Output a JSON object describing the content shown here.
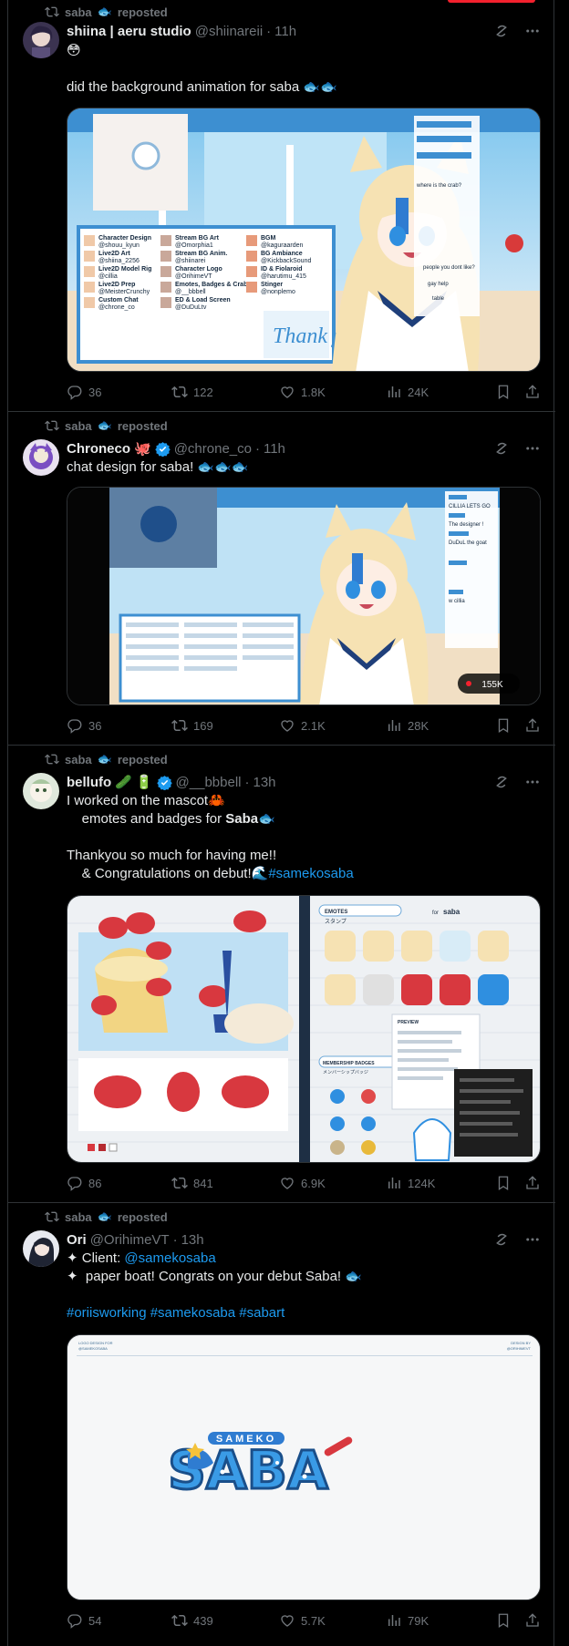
{
  "feed": {
    "tweets": [
      {
        "reposted_by": "saba",
        "reposted_label": "reposted",
        "author": {
          "name": "shiina | aeru studio",
          "handle": "@shiinareii",
          "verified": false
        },
        "time": "11h",
        "text_lines": [
          "😳",
          "",
          "did the background animation for saba 🐟🐟"
        ],
        "media": {
          "credits": [
            {
              "role": "Character Design",
              "name": "@shouu_kyun"
            },
            {
              "role": "Live2D Art",
              "name": "@shiina_2256"
            },
            {
              "role": "Live2D Model Rig",
              "name": "@cillia"
            },
            {
              "role": "Live2D Prep",
              "name": "@MeisterCrunchy"
            },
            {
              "role": "Custom Chat",
              "name": "@chrone_co"
            },
            {
              "role": "Stream BG Art",
              "name": "@Omorphia1"
            },
            {
              "role": "Stream BG Anim.",
              "name": "@shiinarei"
            },
            {
              "role": "Character Logo",
              "name": "@OrihimeVT"
            },
            {
              "role": "Emotes, Badges & Crab",
              "name": "@__bbbell"
            },
            {
              "role": "ED & Load Screen",
              "name": "@DuDuLtv"
            },
            {
              "role": "BGM",
              "name": "@kaguraarden"
            },
            {
              "role": "BG Ambiance",
              "name": "@KickbackSound"
            },
            {
              "role": "ID & Fiolaroid",
              "name": "@harutimu_415"
            },
            {
              "role": "Stinger",
              "name": "@nonplemo"
            }
          ],
          "thanks": "Thank you!",
          "chat_lines": [
            "where is the crab?",
            "people you dont like?",
            "gay help",
            "table"
          ]
        },
        "counts": {
          "replies": "36",
          "reposts": "122",
          "likes": "1.8K",
          "views": "24K"
        }
      },
      {
        "reposted_by": "saba",
        "reposted_label": "reposted",
        "author": {
          "name": "Chroneco",
          "handle": "@chrone_co",
          "verified": true
        },
        "time": "11h",
        "text_lines": [
          "chat design for saba! 🐟🐟🐟"
        ],
        "media": {
          "chat_lines": [
            "CILLIA LETS GO",
            "The designer !",
            "DuDuL the goat",
            "w cillia"
          ],
          "live_count": "155K"
        },
        "counts": {
          "replies": "36",
          "reposts": "169",
          "likes": "2.1K",
          "views": "28K"
        }
      },
      {
        "reposted_by": "saba",
        "reposted_label": "reposted",
        "author": {
          "name": "bellufo",
          "handle": "@__bbbell",
          "verified": true
        },
        "time": "13h",
        "text_lines": [
          "I worked on the mascot🦀",
          "    emotes and badges for ",
          "",
          "Thankyou so much for having me!!",
          "    & Congratulations on debut!🌊"
        ],
        "bold_saba": "Saba🐟",
        "hashtag": "#samekosaba",
        "media": {
          "emotes_label": "EMOTES",
          "emotes_sub": "スタンプ",
          "badges_label": "MEMBERSHIP BADGES",
          "badges_sub": "メンバーシップバッジ",
          "preview_label": "PREVIEW",
          "brand": "saba"
        },
        "counts": {
          "replies": "86",
          "reposts": "841",
          "likes": "6.9K",
          "views": "124K"
        }
      },
      {
        "reposted_by": "saba",
        "reposted_label": "reposted",
        "author": {
          "name": "Ori",
          "handle": "@OrihimeVT",
          "verified": false
        },
        "time": "13h",
        "client_prefix": "✦ Client: ",
        "client_link": "@samekosaba",
        "boat_line": "✦  paper boat! Congrats on your debut Saba! 🐟",
        "hashtags": "#oriisworking #samekosaba #sabart",
        "media": {
          "logo_top": "SAMEKO",
          "logo_main": "SABA",
          "corner_left": "LOGO DESIGN FOR",
          "corner_left2": "@SAMEKOSABA",
          "corner_right": "DESIGN BY",
          "corner_right2": "@ORIHIMEVT"
        },
        "counts": {
          "replies": "54",
          "reposts": "439",
          "likes": "5.7K",
          "views": "79K"
        }
      }
    ]
  },
  "colors": {
    "background": "#000000",
    "text": "#e7e9ea",
    "muted": "#71767b",
    "link": "#1d9bf0",
    "border": "#2f3336",
    "accent": "#f4212e"
  }
}
